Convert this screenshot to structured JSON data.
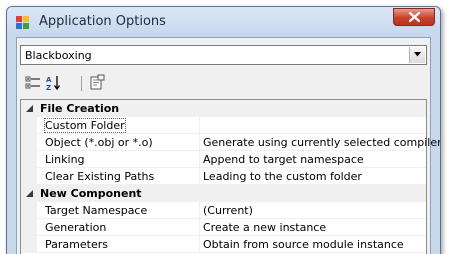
{
  "window": {
    "title": "Application Options",
    "icon": "app-window-icon",
    "close_icon": "close-icon"
  },
  "combo": {
    "selected": "Blackboxing"
  },
  "toolbar": {
    "buttons": [
      {
        "name": "categorized-button",
        "icon": "categorized-icon"
      },
      {
        "name": "alphabetical-button",
        "icon": "sort-az-icon"
      },
      {
        "name": "property-pages-button",
        "icon": "property-pages-icon"
      }
    ]
  },
  "categories": [
    {
      "label": "File Creation",
      "properties": [
        {
          "name": "Custom Folder",
          "value": ""
        },
        {
          "name": "Object (*.obj or *.o)",
          "value": "Generate using currently selected compiler"
        },
        {
          "name": "Linking",
          "value": "Append to target namespace"
        },
        {
          "name": "Clear Existing Paths",
          "value": "Leading to the custom folder"
        }
      ]
    },
    {
      "label": "New Component",
      "properties": [
        {
          "name": "Target Namespace",
          "value": "(Current)"
        },
        {
          "name": "Generation",
          "value": "Create a new instance"
        },
        {
          "name": "Parameters",
          "value": "Obtain from source module instance"
        }
      ]
    }
  ],
  "colors": {
    "title_bar": "#c5d7ed",
    "close_button": "#c9412c",
    "grid_gutter": "#f0f0f0"
  }
}
